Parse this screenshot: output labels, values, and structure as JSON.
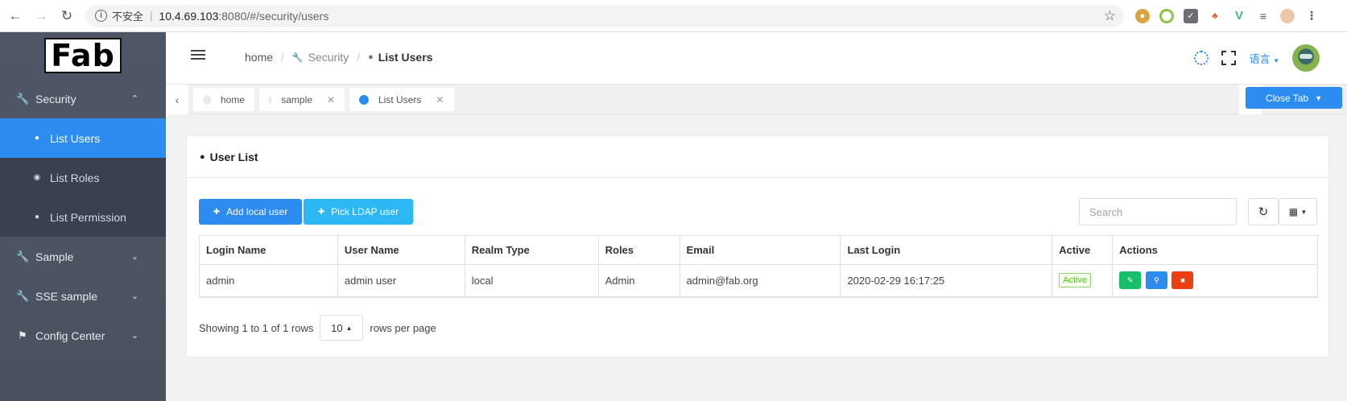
{
  "browser": {
    "insecure_label": "不安全",
    "url_host": "10.4.69.103",
    "url_rest": ":8080/#/security/users"
  },
  "sidebar": {
    "logo": "Fab",
    "items": [
      {
        "label": "Security",
        "icon": "wrench-icon",
        "expanded": true
      },
      {
        "label": "Sample",
        "icon": "wrench-icon",
        "expanded": false
      },
      {
        "label": "SSE sample",
        "icon": "wrench-icon",
        "expanded": false
      },
      {
        "label": "Config Center",
        "icon": "flag-icon",
        "expanded": false
      }
    ],
    "security_children": [
      {
        "label": "List Users",
        "icon": "users-icon",
        "active": true
      },
      {
        "label": "List Roles",
        "icon": "roles-icon",
        "active": false
      },
      {
        "label": "List Permission",
        "icon": "circle-icon",
        "active": false
      }
    ]
  },
  "header": {
    "breadcrumb": [
      "home",
      "Security",
      "List Users"
    ],
    "language_label": "语言"
  },
  "tabs": [
    {
      "label": "home",
      "closable": false,
      "active": false
    },
    {
      "label": "sample",
      "closable": true,
      "active": false
    },
    {
      "label": "List Users",
      "closable": true,
      "active": true
    }
  ],
  "close_tab_label": "Close Tab",
  "card": {
    "title": "User List",
    "add_local_label": "Add local user",
    "pick_ldap_label": "Pick LDAP user",
    "search_placeholder": "Search"
  },
  "table": {
    "columns": [
      "Login Name",
      "User Name",
      "Realm Type",
      "Roles",
      "Email",
      "Last Login",
      "Active",
      "Actions"
    ],
    "rows": [
      {
        "login_name": "admin",
        "user_name": "admin user",
        "realm_type": "local",
        "roles": "Admin",
        "email": "admin@fab.org",
        "last_login": "2020-02-29 16:17:25",
        "active": "Active"
      }
    ]
  },
  "pagination": {
    "showing_text": "Showing 1 to 1 of 1 rows",
    "page_size": "10",
    "rows_per_page_label": "rows per page"
  },
  "colors": {
    "primary": "#2d8cf0",
    "info": "#2db7f5",
    "success": "#19be6b",
    "danger": "#ed3f14",
    "sidebar_bg": "#4d5563"
  }
}
